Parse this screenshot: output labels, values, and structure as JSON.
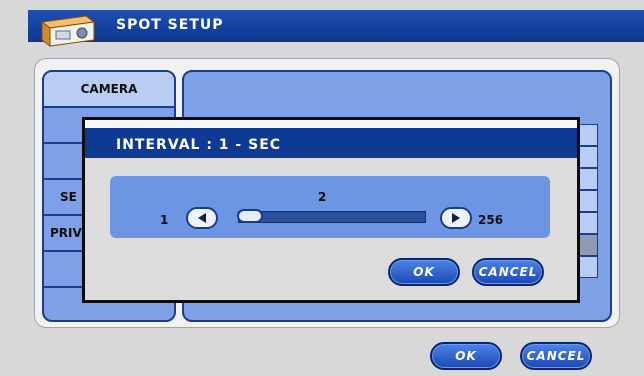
{
  "window": {
    "title": "SPOT SETUP"
  },
  "left_menu": {
    "items": [
      {
        "label": "CAMERA"
      },
      {
        "label": ""
      },
      {
        "label": ""
      },
      {
        "label": "SE"
      },
      {
        "label": "PRIV"
      },
      {
        "label": ""
      },
      {
        "label": ""
      }
    ]
  },
  "footer": {
    "ok_label": "OK",
    "cancel_label": "CANCEL"
  },
  "dialog": {
    "title": "INTERVAL : 1 - SEC",
    "slider": {
      "value": "2",
      "min_label": "1",
      "max_label": "256",
      "value_num": 2,
      "min": 1,
      "max": 256
    },
    "ok_label": "OK",
    "cancel_label": "CANCEL"
  },
  "colors": {
    "title_bar": "#0f3a94",
    "panel": "#7da0e6",
    "button": "#1a48b5"
  }
}
